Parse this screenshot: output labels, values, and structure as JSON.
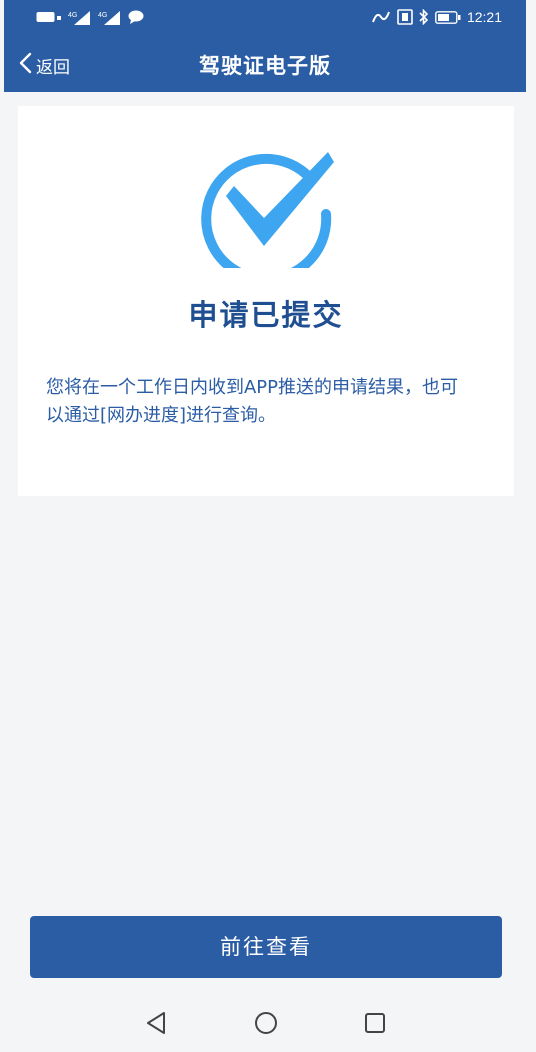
{
  "status_bar": {
    "time": "12:21"
  },
  "nav": {
    "back_label": "返回",
    "title": "驾驶证电子版"
  },
  "result": {
    "icon": "check-circle-icon",
    "title": "申请已提交",
    "description": "您将在一个工作日内收到APP推送的申请结果，也可以通过[网办进度]进行查询。"
  },
  "actions": {
    "primary_label": "前往查看"
  },
  "colors": {
    "header": "#2b5da5",
    "accent": "#3ea6f0",
    "title_text": "#1f4e91"
  }
}
